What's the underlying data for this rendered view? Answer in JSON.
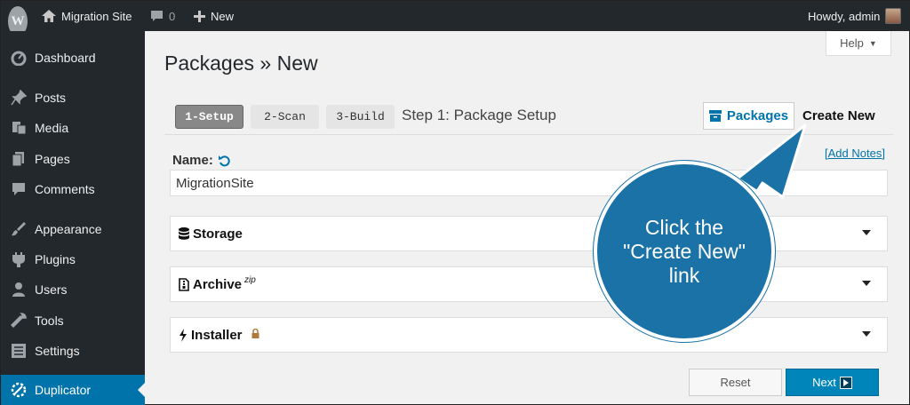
{
  "admin_bar": {
    "site_name": "Migration Site",
    "comments_count": "0",
    "new_label": "New",
    "howdy": "Howdy, admin"
  },
  "sidebar": {
    "items": [
      {
        "label": "Dashboard",
        "icon": "dashboard-icon"
      },
      {
        "label": "Posts",
        "icon": "pin-icon"
      },
      {
        "label": "Media",
        "icon": "media-icon"
      },
      {
        "label": "Pages",
        "icon": "pages-icon"
      },
      {
        "label": "Comments",
        "icon": "comments-icon"
      },
      {
        "label": "Appearance",
        "icon": "brush-icon"
      },
      {
        "label": "Plugins",
        "icon": "plugin-icon"
      },
      {
        "label": "Users",
        "icon": "user-icon"
      },
      {
        "label": "Tools",
        "icon": "wrench-icon"
      },
      {
        "label": "Settings",
        "icon": "settings-icon"
      },
      {
        "label": "Duplicator",
        "icon": "duplicator-icon",
        "active": true
      }
    ]
  },
  "help_label": "Help",
  "page_title": "Packages » New",
  "steps": [
    "1-Setup",
    "2-Scan",
    "3-Build"
  ],
  "step_caption": "Step 1: Package Setup",
  "packages_button": "Packages",
  "create_new_link": "Create New",
  "name_label": "Name:",
  "add_notes_link": "[Add Notes]",
  "name_value": "MigrationSite",
  "panels": {
    "storage": "Storage",
    "archive": "Archive",
    "archive_sup": "zip",
    "installer": "Installer"
  },
  "buttons": {
    "reset": "Reset",
    "next": "Next"
  },
  "callout": {
    "line1": "Click the",
    "line2": "\"Create New\"",
    "line3": "link"
  },
  "colors": {
    "admin_bar": "#23282d",
    "accent": "#0073aa",
    "callout": "#1a72a6"
  }
}
